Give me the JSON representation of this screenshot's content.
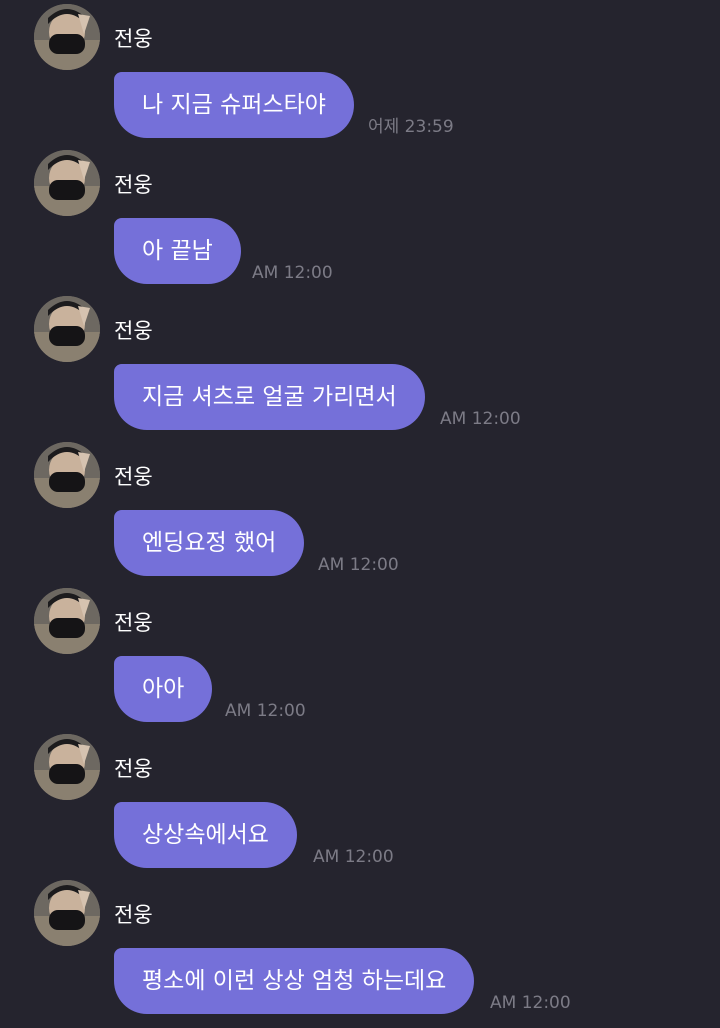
{
  "chat": {
    "messages": [
      {
        "sender": "전웅",
        "text": "나 지금 슈퍼스타야",
        "time": "어제 23:59"
      },
      {
        "sender": "전웅",
        "text": "아 끝남",
        "time": "AM 12:00"
      },
      {
        "sender": "전웅",
        "text": "지금 셔츠로 얼굴 가리면서",
        "time": "AM 12:00"
      },
      {
        "sender": "전웅",
        "text": "엔딩요정 했어",
        "time": "AM 12:00"
      },
      {
        "sender": "전웅",
        "text": "아아",
        "time": "AM 12:00"
      },
      {
        "sender": "전웅",
        "text": "상상속에서요",
        "time": "AM 12:00"
      },
      {
        "sender": "전웅",
        "text": "평소에 이런 상상 엄청 하는데요",
        "time": "AM 12:00"
      }
    ],
    "colors": {
      "background": "#25242e",
      "bubble": "#7570d9",
      "text": "#ffffff",
      "timestamp": "#7c7b86"
    }
  }
}
